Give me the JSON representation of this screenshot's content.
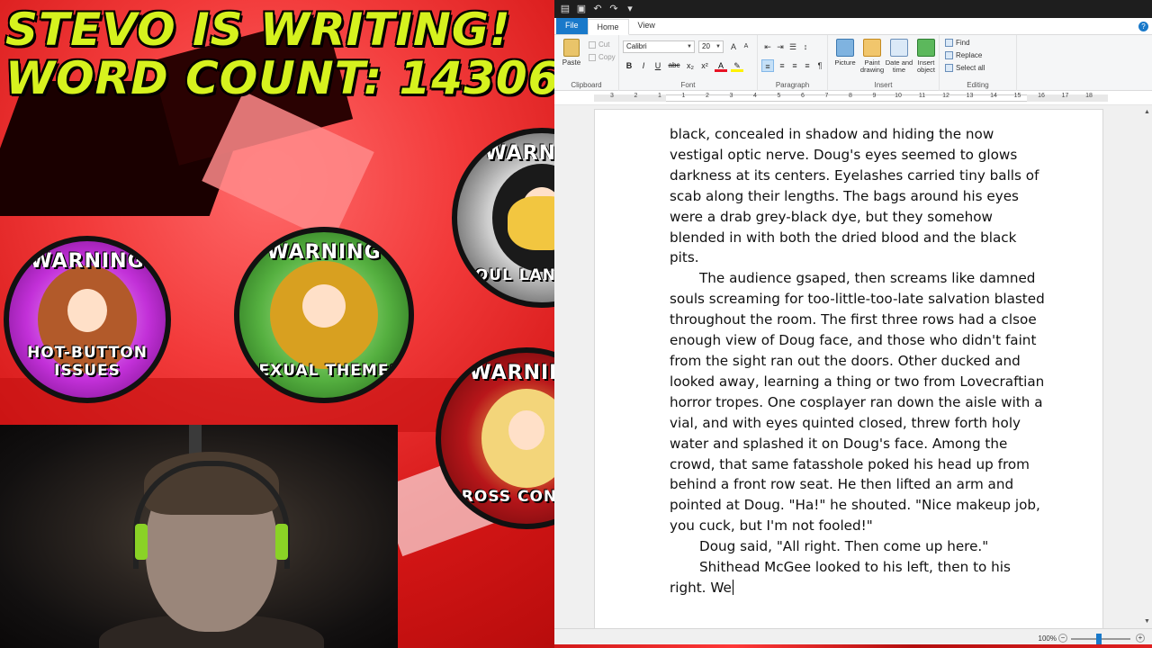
{
  "overlay": {
    "title_line1": "STEVO IS WRITING!",
    "title_line2": "WORD COUNT: 14306",
    "badges": {
      "hot_button": {
        "top": "WARNING",
        "bottom": "HOT-BUTTON ISSUES"
      },
      "sexual": {
        "top": "WARNING",
        "bottom": "SEXUAL THEMES"
      },
      "foul": {
        "top": "WARNING",
        "bottom": "FOUL LANGUAGE"
      },
      "gross": {
        "top": "WARNING",
        "bottom": "GROSS CONTENT"
      }
    },
    "colors": {
      "title": "#d6f21e",
      "background": "#e82a2a"
    }
  },
  "wordpad": {
    "tabs": {
      "file": "File",
      "home": "Home",
      "view": "View"
    },
    "clipboard": {
      "paste": "Paste",
      "cut": "Cut",
      "copy": "Copy",
      "label": "Clipboard"
    },
    "font": {
      "name": "Calibri",
      "size": "20",
      "label": "Font",
      "bold": "B",
      "italic": "I",
      "underline": "U",
      "strike": "abc",
      "sub": "x₂",
      "sup": "x²",
      "color": "A",
      "highlight": "✎"
    },
    "paragraph": {
      "label": "Paragraph"
    },
    "insert": {
      "picture": "Picture",
      "paint": "Paint drawing",
      "datetime": "Date and time",
      "object": "Insert object",
      "label": "Insert"
    },
    "editing": {
      "find": "Find",
      "replace": "Replace",
      "select_all": "Select all",
      "label": "Editing"
    },
    "ruler_ticks": [
      "3",
      "2",
      "1",
      "1",
      "2",
      "3",
      "4",
      "5",
      "6",
      "7",
      "8",
      "9",
      "10",
      "11",
      "12",
      "13",
      "14",
      "15",
      "16",
      "17",
      "18"
    ],
    "zoom": "100%",
    "document": {
      "p1": "black, concealed in shadow and hiding the now vestigal optic nerve. Doug's eyes seemed to glows darkness at its centers. Eyelashes carried tiny balls of scab along their lengths. The bags around his eyes were a drab grey-black dye, but they somehow blended in with both the dried blood and the black pits.",
      "p2": "The audience gsaped, then screams like damned souls screaming for too-little-too-late salvation blasted throughout the room. The first three rows had a clsoe enough view of Doug face, and those who didn't faint from the sight ran out the doors. Other ducked and looked away, learning a thing or two from Lovecraftian horror tropes. One cosplayer ran down the aisle with a vial, and with eyes quinted closed, threw forth holy water and splashed it on Doug's face. Among the crowd, that same fatasshole poked his head up from behind a front row seat. He then lifted an arm and pointed at Doug. \"Ha!\" he shouted. \"Nice makeup job, you cuck, but I'm not fooled!\"",
      "p3": "Doug said, \"All right. Then come up here.\"",
      "p4": "Shithead McGee looked to his left, then to his right. We"
    }
  }
}
